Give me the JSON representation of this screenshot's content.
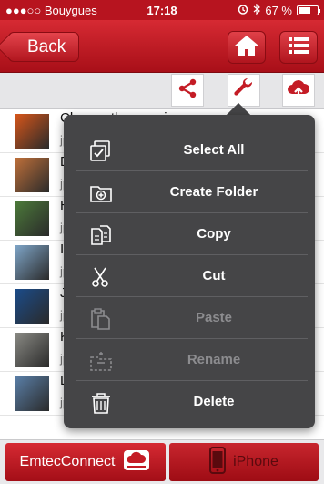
{
  "status_bar": {
    "carrier": "●●●○○ Bouygues",
    "time": "17:18",
    "battery": "67 %",
    "battery_level": 0.67
  },
  "nav": {
    "back_label": "Back",
    "home_icon": "home-icon",
    "menu_icon": "list-menu-icon"
  },
  "toolbar": {
    "share_icon": "share-icon",
    "tools_icon": "wrench-icon",
    "upload_icon": "cloud-upload-icon"
  },
  "files": [
    {
      "name": "Chrysanthemum.jpg",
      "sub": "jp",
      "thumb_color": "#d8561a"
    },
    {
      "name": "D",
      "sub": "jp",
      "thumb_color": "#c0703a"
    },
    {
      "name": "H",
      "sub": "jp",
      "thumb_color": "#4c7a3a"
    },
    {
      "name": "I",
      "sub": "jp",
      "thumb_color": "#7fa6c9"
    },
    {
      "name": "J",
      "sub": "jp",
      "thumb_color": "#1b4c8a"
    },
    {
      "name": "K",
      "sub": "jp",
      "thumb_color": "#8a8a84"
    },
    {
      "name": "L",
      "sub": "jp",
      "thumb_color": "#5a7fa8"
    }
  ],
  "menu": {
    "items": [
      {
        "label": "Select All",
        "icon": "select-all-icon",
        "enabled": true
      },
      {
        "label": "Create Folder",
        "icon": "create-folder-icon",
        "enabled": true
      },
      {
        "label": "Copy",
        "icon": "copy-icon",
        "enabled": true
      },
      {
        "label": "Cut",
        "icon": "scissors-icon",
        "enabled": true
      },
      {
        "label": "Paste",
        "icon": "paste-icon",
        "enabled": false
      },
      {
        "label": "Rename",
        "icon": "rename-icon",
        "enabled": false
      },
      {
        "label": "Delete",
        "icon": "trash-icon",
        "enabled": true
      }
    ]
  },
  "tabs": [
    {
      "label": "EmtecConnect",
      "icon": "cloud-device-icon",
      "active": true
    },
    {
      "label": "iPhone",
      "icon": "phone-icon",
      "active": false
    }
  ],
  "colors": {
    "brand_red": "#c41c25",
    "menu_bg": "#454547",
    "disabled_text": "#8c8c8f"
  }
}
